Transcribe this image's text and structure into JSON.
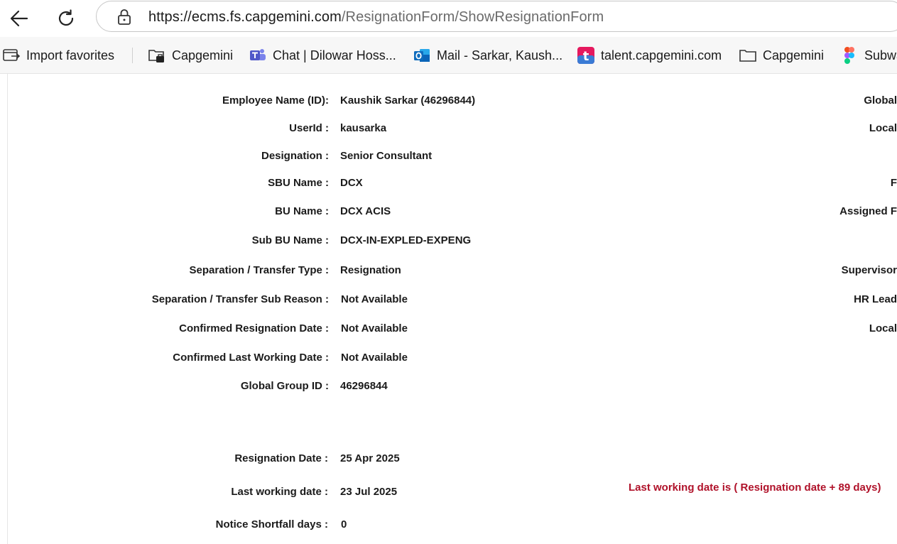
{
  "browser": {
    "url_host": "https://ecms.fs.capgemini.com",
    "url_path": "/ResignationForm/ShowResignationForm"
  },
  "favorites": [
    {
      "label": "Import favorites",
      "icon": "import-favorites-icon"
    },
    {
      "label": "Capgemini",
      "icon": "folder-briefcase-icon"
    },
    {
      "label": "Chat | Dilowar Hoss...",
      "icon": "teams-icon"
    },
    {
      "label": "Mail - Sarkar, Kaush...",
      "icon": "outlook-icon"
    },
    {
      "label": "talent.capgemini.com",
      "icon": "talent-icon"
    },
    {
      "label": "Capgemini",
      "icon": "folder-icon"
    },
    {
      "label": "Subwa",
      "icon": "figma-icon"
    }
  ],
  "form": {
    "fields": [
      {
        "label": "Employee Name (ID):",
        "value": "Kaushik Sarkar (46296844)"
      },
      {
        "label": "UserId :",
        "value": "kausarka"
      },
      {
        "label": "Designation :",
        "value": "Senior Consultant"
      },
      {
        "label": "SBU Name :",
        "value": "DCX"
      },
      {
        "label": "BU Name :",
        "value": "DCX ACIS"
      },
      {
        "label": "Sub BU Name :",
        "value": "DCX-IN-EXPLED-EXPENG"
      },
      {
        "label": "Separation / Transfer Type :",
        "value": "Resignation"
      },
      {
        "label": "Separation / Transfer Sub Reason :",
        "value": "Not Available"
      },
      {
        "label": "Confirmed Resignation Date :",
        "value": "Not Available"
      },
      {
        "label": "Confirmed Last Working Date :",
        "value": "Not Available"
      },
      {
        "label": "Global Group ID :",
        "value": "46296844"
      },
      {
        "label": "Resignation Date :",
        "value": "25 Apr 2025"
      },
      {
        "label": "Last working date :",
        "value": "23 Jul 2025"
      },
      {
        "label": "Notice Shortfall days :",
        "value": "0"
      }
    ],
    "right_labels": [
      "Global",
      "Local",
      "F",
      "Assigned F",
      "Supervisor",
      "HR Lead",
      "Local"
    ],
    "note": "Last working date is ( Resignation date + 89 days)"
  },
  "colors": {
    "note": "#b0122a"
  }
}
